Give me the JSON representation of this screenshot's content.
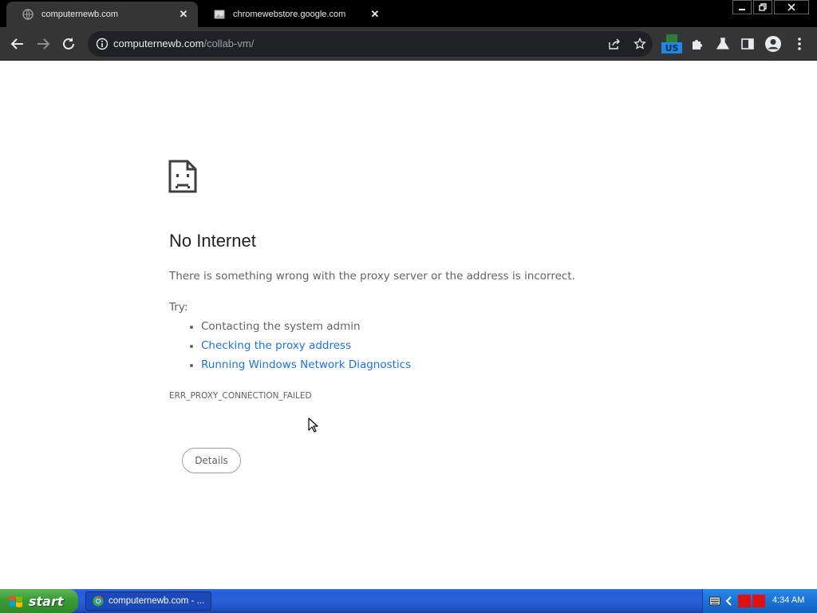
{
  "browser": {
    "tabs": [
      {
        "title": "computernewb.com",
        "active": true
      },
      {
        "title": "chromewebstore.google.com",
        "active": false
      }
    ],
    "address": {
      "host": "computernewb.com",
      "path": "/collab-vm/"
    },
    "extension_badge": "US"
  },
  "page": {
    "heading": "No Internet",
    "description": "There is something wrong with the proxy server or the address is incorrect.",
    "try_label": "Try:",
    "suggestions": [
      {
        "text": "Contacting the system admin",
        "is_link": false
      },
      {
        "text": "Checking the proxy address",
        "is_link": true
      },
      {
        "text": "Running Windows Network Diagnostics",
        "is_link": true
      }
    ],
    "error_code": "ERR_PROXY_CONNECTION_FAILED",
    "details_label": "Details"
  },
  "taskbar": {
    "start_label": "start",
    "task_label": "computernewb.com - ...",
    "clock": "4:34 AM"
  },
  "colors": {
    "link": "#1a73e8",
    "chrome_dark": "#353535",
    "taskbar_blue": "#245edb",
    "start_green": "#3a9a34"
  }
}
